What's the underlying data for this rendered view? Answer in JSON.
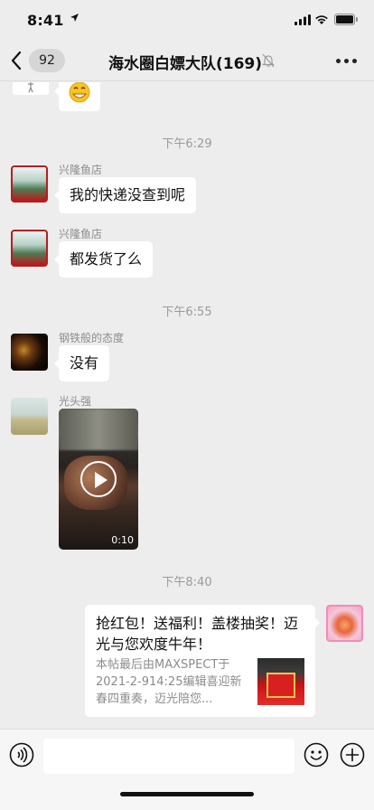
{
  "status_bar": {
    "time": "8:41"
  },
  "nav": {
    "unread_count": "92",
    "title": "海水圈白嫖大队(169)"
  },
  "messages": [
    {
      "type": "timestamp",
      "text": "下午6:29"
    },
    {
      "type": "text",
      "sender": "兴隆鱼店",
      "text": "我的快递没查到呢"
    },
    {
      "type": "text",
      "sender": "兴隆鱼店",
      "text": "都发货了么"
    },
    {
      "type": "timestamp",
      "text": "下午6:55"
    },
    {
      "type": "text",
      "sender": "钢铁般的态度",
      "text": "没有"
    },
    {
      "type": "video",
      "sender": "光头强",
      "duration": "0:10"
    },
    {
      "type": "timestamp",
      "text": "下午8:40"
    },
    {
      "type": "link",
      "sender": "me",
      "title": "抢红包！送福利！盖楼抽奖！迈光与您欢度牛年！",
      "description": "本帖最后由MAXSPECT于2021-2-914:25编辑喜迎新春四重奏，迈光陪您..."
    }
  ],
  "icons": {
    "back": "chevron-left-icon",
    "mute": "bell-slash-icon",
    "more": "ellipsis-icon",
    "voice": "voice-icon",
    "emoji": "emoji-icon",
    "plus": "plus-circle-icon",
    "play": "play-icon"
  },
  "colors": {
    "background": "#ededed",
    "bubble": "#ffffff",
    "timestamp": "#9a9a9a"
  }
}
